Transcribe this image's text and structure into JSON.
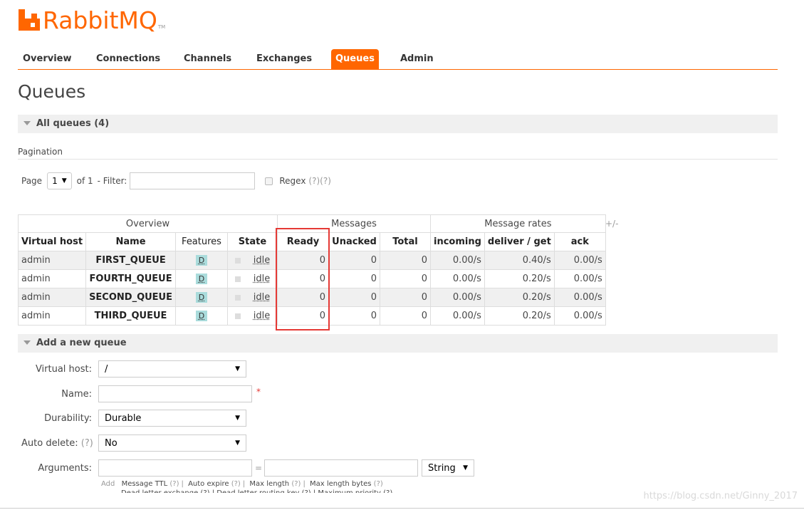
{
  "logo": {
    "text": "RabbitMQ",
    "tm": "TM"
  },
  "nav": {
    "tabs": [
      {
        "label": "Overview"
      },
      {
        "label": "Connections"
      },
      {
        "label": "Channels"
      },
      {
        "label": "Exchanges"
      },
      {
        "label": "Queues",
        "active": true
      },
      {
        "label": "Admin"
      }
    ]
  },
  "page": {
    "title": "Queues"
  },
  "all_queues": {
    "heading": "All queues (4)"
  },
  "pagination": {
    "label": "Pagination",
    "page_label": "Page",
    "page_value": "1",
    "of_label": "of 1",
    "filter_label": "- Filter:",
    "filter_value": "",
    "regex_label": "Regex",
    "regex_help": "(?)(?)"
  },
  "table": {
    "groups": {
      "overview": "Overview",
      "messages": "Messages",
      "rates": "Message rates",
      "toggle": "+/-"
    },
    "columns": [
      "Virtual host",
      "Name",
      "Features",
      "State",
      "Ready",
      "Unacked",
      "Total",
      "incoming",
      "deliver / get",
      "ack"
    ],
    "rows": [
      {
        "vhost": "admin",
        "name": "FIRST_QUEUE",
        "feature": "D",
        "state": "idle",
        "ready": "0",
        "unacked": "0",
        "total": "0",
        "incoming": "0.00/s",
        "deliver": "0.40/s",
        "ack": "0.00/s"
      },
      {
        "vhost": "admin",
        "name": "FOURTH_QUEUE",
        "feature": "D",
        "state": "idle",
        "ready": "0",
        "unacked": "0",
        "total": "0",
        "incoming": "0.00/s",
        "deliver": "0.20/s",
        "ack": "0.00/s"
      },
      {
        "vhost": "admin",
        "name": "SECOND_QUEUE",
        "feature": "D",
        "state": "idle",
        "ready": "0",
        "unacked": "0",
        "total": "0",
        "incoming": "0.00/s",
        "deliver": "0.20/s",
        "ack": "0.00/s"
      },
      {
        "vhost": "admin",
        "name": "THIRD_QUEUE",
        "feature": "D",
        "state": "idle",
        "ready": "0",
        "unacked": "0",
        "total": "0",
        "incoming": "0.00/s",
        "deliver": "0.20/s",
        "ack": "0.00/s"
      }
    ]
  },
  "add_queue": {
    "heading": "Add a new queue",
    "vhost_label": "Virtual host:",
    "vhost_value": "/",
    "name_label": "Name:",
    "name_value": "",
    "required_mark": "*",
    "durability_label": "Durability:",
    "durability_value": "Durable",
    "auto_delete_label": "Auto delete:",
    "auto_delete_help": "(?)",
    "auto_delete_value": "No",
    "arguments_label": "Arguments:",
    "equals": "=",
    "arg_type_value": "String",
    "add_label": "Add",
    "arg_links": [
      "Message TTL",
      "Auto expire",
      "Max length",
      "Max length bytes"
    ],
    "arg_help": "(?)",
    "arg_links_row2": "Dead letter exchange (?) | Dead letter routing key (?) | Maximum priority (?)"
  },
  "watermark": "https://blog.csdn.net/Ginny_2017",
  "colors": {
    "brand": "#ff6600",
    "highlight": "#e53935",
    "feature_badge": "#aadcdc"
  }
}
